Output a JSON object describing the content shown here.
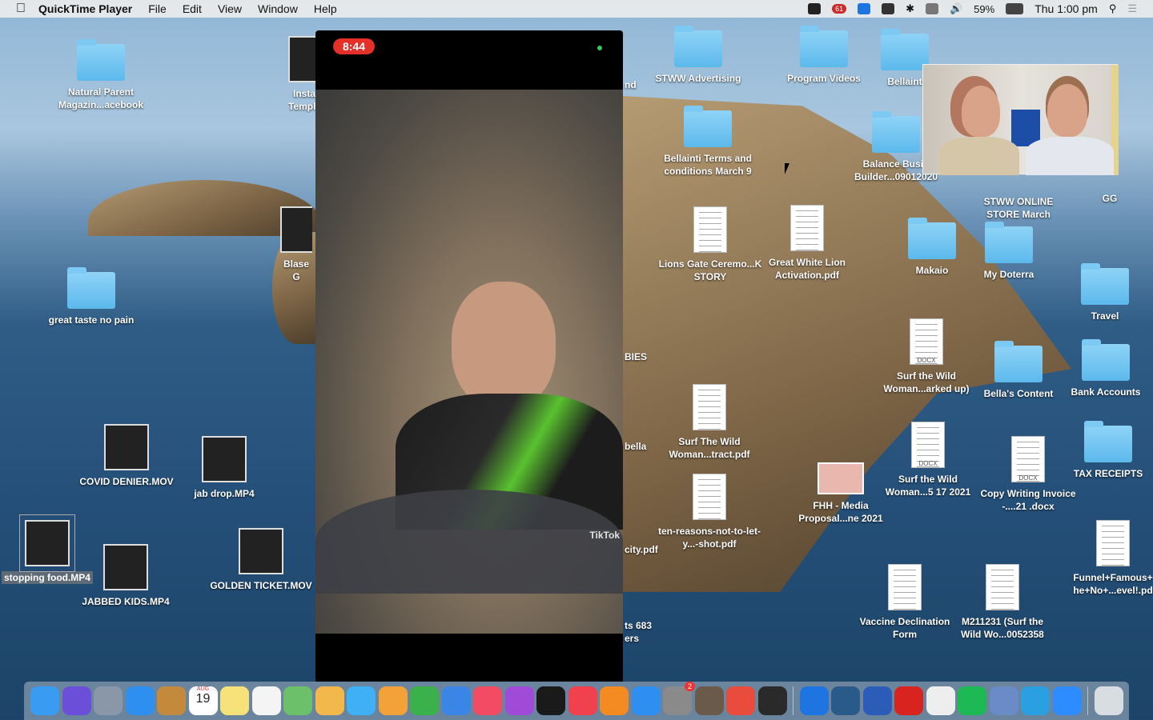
{
  "menubar": {
    "app": "QuickTime Player",
    "menus": [
      "File",
      "Edit",
      "View",
      "Window",
      "Help"
    ],
    "status": {
      "notification_badge": "61",
      "battery": "59%",
      "clock": "Thu 1:00 pm"
    },
    "status_icons": [
      "dropbox-icon",
      "notification-icon",
      "teamviewer-icon",
      "creative-cloud-icon",
      "bluetooth-icon",
      "airplay-icon",
      "volume-icon",
      "battery-icon",
      "search-icon",
      "control-center-icon"
    ]
  },
  "desktop": {
    "items": [
      {
        "label": "Natural Parent Magazin...acebook",
        "kind": "folder"
      },
      {
        "label": "great taste no pain",
        "kind": "folder"
      },
      {
        "label": "COVID DENIER.MOV",
        "kind": "video"
      },
      {
        "label": "jab drop.MP4",
        "kind": "video"
      },
      {
        "label": "stopping food.MP4",
        "kind": "video",
        "selected": true
      },
      {
        "label": "JABBED KIDS.MP4",
        "kind": "video"
      },
      {
        "label": "GOLDEN TICKET.MOV",
        "kind": "video"
      },
      {
        "label": "STWW Advertising",
        "kind": "folder"
      },
      {
        "label": "Program Videos",
        "kind": "folder"
      },
      {
        "label": "Bellaint",
        "kind": "folder"
      },
      {
        "label": "Bellainti Terms and conditions March 9",
        "kind": "folder"
      },
      {
        "label": "Balance Busin Builder...09012020",
        "kind": "folder"
      },
      {
        "label": "STWW ONLINE STORE March",
        "kind": "folder"
      },
      {
        "label": "GG",
        "kind": "folder"
      },
      {
        "label": "Lions Gate Ceremo...K STORY",
        "kind": "doc"
      },
      {
        "label": "Great White Lion Activation.pdf",
        "kind": "doc"
      },
      {
        "label": "Makaio",
        "kind": "folder"
      },
      {
        "label": "My Doterra",
        "kind": "folder"
      },
      {
        "label": "Travel",
        "kind": "folder"
      },
      {
        "label": "Surf the Wild Woman...arked up)",
        "kind": "docx"
      },
      {
        "label": "Bella's Content",
        "kind": "folder"
      },
      {
        "label": "Bank Accounts",
        "kind": "folder"
      },
      {
        "label": "Surf The Wild Woman...tract.pdf",
        "kind": "doc"
      },
      {
        "label": "Surf the Wild Woman...5 17 2021",
        "kind": "docx"
      },
      {
        "label": "Copy Writing Invoice -....21 .docx",
        "kind": "docx"
      },
      {
        "label": "TAX RECEIPTS",
        "kind": "folder"
      },
      {
        "label": "FHH - Media Proposal...ne 2021",
        "kind": "image"
      },
      {
        "label": "ten-reasons-not-to-let-y...-shot.pdf",
        "kind": "doc"
      },
      {
        "label": "Funnel+Famous+ he+No+...evel!.pd",
        "kind": "doc"
      },
      {
        "label": "Vaccine Declination Form",
        "kind": "doc"
      },
      {
        "label": "M211231 (Surf the Wild Wo...0052358",
        "kind": "doc"
      },
      {
        "label": "Insta Templa",
        "kind": "video"
      },
      {
        "label": "Blase G",
        "kind": "video"
      }
    ],
    "partial_labels": [
      "nd",
      "BIES",
      "bella",
      "city.pdf",
      "ts 683 ers"
    ],
    "docx_tag": "DOCX"
  },
  "player": {
    "timer": "8:44",
    "watermark": "TikTok"
  },
  "dock": {
    "calendar_month": "AUG",
    "calendar_day": "19",
    "badge": "2",
    "apps": [
      {
        "name": "finder",
        "color": "#3a9cf0"
      },
      {
        "name": "siri",
        "color": "#6b4fd8"
      },
      {
        "name": "launchpad",
        "color": "#8a97a8"
      },
      {
        "name": "safari",
        "color": "#2f8ff0"
      },
      {
        "name": "notefile",
        "color": "#c48a3c"
      },
      {
        "name": "calendar",
        "color": "#ffffff"
      },
      {
        "name": "notes",
        "color": "#f7e27a"
      },
      {
        "name": "reminders",
        "color": "#f4f4f4"
      },
      {
        "name": "maps",
        "color": "#6cc06a"
      },
      {
        "name": "photos",
        "color": "#f2b84b"
      },
      {
        "name": "messages",
        "color": "#3fb0f5"
      },
      {
        "name": "pages",
        "color": "#f3a23a"
      },
      {
        "name": "numbers",
        "color": "#3cb04b"
      },
      {
        "name": "keynote",
        "color": "#3a86e6"
      },
      {
        "name": "music",
        "color": "#f34b63"
      },
      {
        "name": "podcasts",
        "color": "#a04bd8"
      },
      {
        "name": "apple-tv",
        "color": "#1a1a1a"
      },
      {
        "name": "news",
        "color": "#f1414f"
      },
      {
        "name": "books",
        "color": "#f48a22"
      },
      {
        "name": "app-store",
        "color": "#2f8ff0"
      },
      {
        "name": "system-preferences",
        "color": "#8a8a8a"
      },
      {
        "name": "archive",
        "color": "#6a5a4a"
      },
      {
        "name": "chrome",
        "color": "#e94b3c"
      },
      {
        "name": "screenshot",
        "color": "#2a2a2a"
      },
      {
        "name": "teamviewer",
        "color": "#1e74e0"
      },
      {
        "name": "search",
        "color": "#2a5a8a"
      },
      {
        "name": "word",
        "color": "#2b5cb8"
      },
      {
        "name": "acrobat",
        "color": "#d8231f"
      },
      {
        "name": "textedit",
        "color": "#eeeeee"
      },
      {
        "name": "spotify",
        "color": "#1db954"
      },
      {
        "name": "preview",
        "color": "#6a8ac8"
      },
      {
        "name": "telegram",
        "color": "#2aa0e0"
      },
      {
        "name": "zoom",
        "color": "#2d8cff"
      },
      {
        "name": "trash",
        "color": "#d8dde2"
      }
    ]
  }
}
